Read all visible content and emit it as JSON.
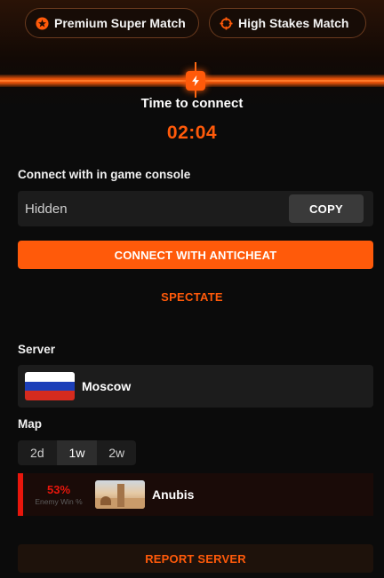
{
  "match_types": [
    {
      "label": "Premium Super Match",
      "icon": "star-circle-icon"
    },
    {
      "label": "High Stakes Match",
      "icon": "crosshair-icon"
    }
  ],
  "connect": {
    "time_label": "Time to connect",
    "timer": "02:04",
    "console_label": "Connect with in game console",
    "console_value": "Hidden",
    "copy_label": "COPY",
    "anticheat_label": "CONNECT WITH ANTICHEAT",
    "spectate_label": "SPECTATE"
  },
  "server": {
    "label": "Server",
    "name": "Moscow",
    "flag": "russia"
  },
  "map": {
    "label": "Map",
    "periods": [
      "2d",
      "1w",
      "2w"
    ],
    "active_period": "1w",
    "win_pct": "53%",
    "win_label": "Enemy Win %",
    "name": "Anubis"
  },
  "report_label": "REPORT SERVER",
  "colors": {
    "accent": "#ff5a0a",
    "danger": "#e8160c",
    "background": "#0b0b0b",
    "panel": "#1c1c1c"
  }
}
